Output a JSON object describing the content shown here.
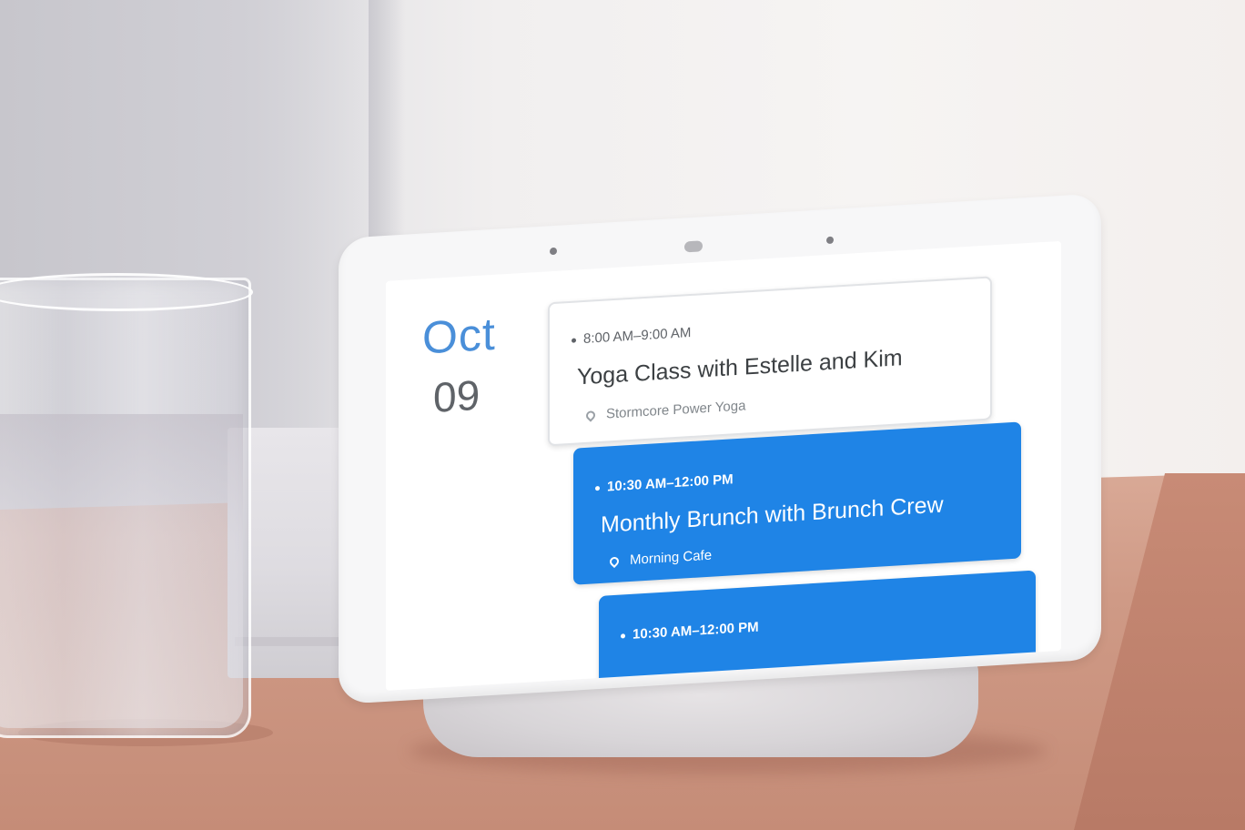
{
  "calendar": {
    "month": "Oct",
    "day": "09",
    "accent_color": "#4a8fd9",
    "events": [
      {
        "time": "8:00 AM–9:00 AM",
        "title": "Yoga Class with Estelle and Kim",
        "location": "Stormcore Power Yoga",
        "style": "white"
      },
      {
        "time": "10:30 AM–12:00 PM",
        "title": "Monthly Brunch with Brunch Crew",
        "location": "Morning Cafe",
        "style": "blue",
        "color": "#1f84e6"
      },
      {
        "time": "10:30 AM–12:00 PM",
        "style": "blue",
        "color": "#1f84e6"
      }
    ]
  }
}
